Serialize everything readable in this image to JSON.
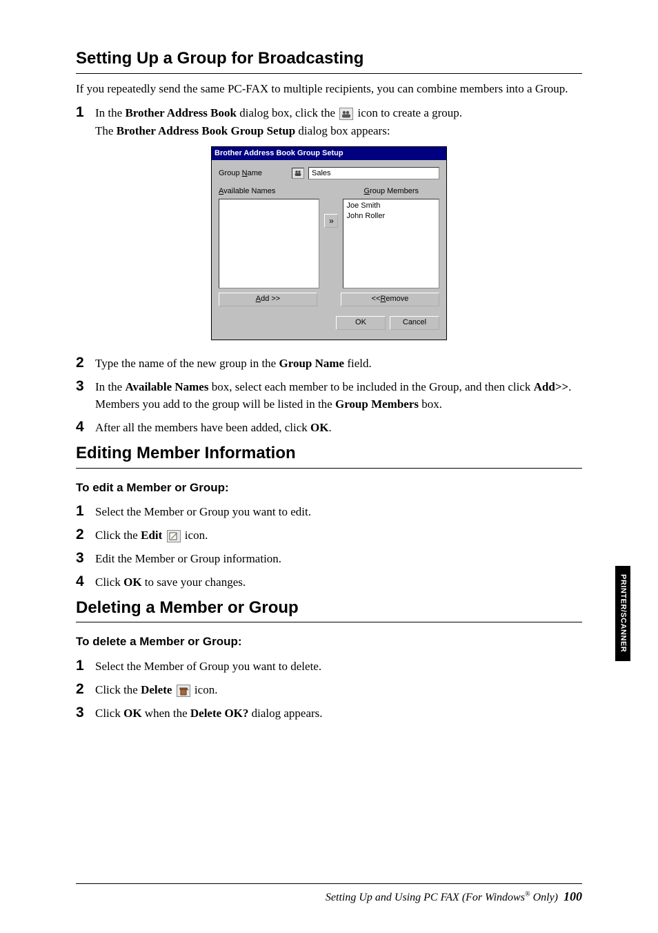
{
  "section1": {
    "heading": "Setting Up a Group for Broadcasting",
    "intro": "If you repeatedly send the same PC-FAX to multiple recipients, you can combine members into a Group.",
    "step1a": "In the ",
    "step1b": "Brother Address Book",
    "step1c": " dialog box, click the ",
    "step1d": " icon to create a group.",
    "step1line2a": "The ",
    "step1line2b": "Brother Address Book Group Setup",
    "step1line2c": " dialog box appears:",
    "step2a": "Type the name of the new group in the ",
    "step2b": "Group Name",
    "step2c": " field.",
    "step3a": "In the ",
    "step3b": "Available Names",
    "step3c": " box, select each member to be included in the Group, and then click ",
    "step3d": "Add>>",
    "step3e": ".",
    "step3line2a": "Members you add to the group will be listed in the ",
    "step3line2b": "Group Members",
    "step3line2c": " box.",
    "step4a": "After all the members have been added, click ",
    "step4b": "OK",
    "step4c": "."
  },
  "dialog": {
    "title": "Brother Address Book Group Setup",
    "groupNameLabel_pre": "Group ",
    "groupNameLabel_u": "N",
    "groupNameLabel_post": "ame",
    "groupNameValue": "Sales",
    "availableLabel_u": "A",
    "availableLabel_post": "vailable Names",
    "membersLabel_u": "G",
    "membersLabel_post": "roup Members",
    "member1": "Joe Smith",
    "member2": "John Roller",
    "arrow": "»",
    "addBtn_u": "A",
    "addBtn_post": "dd >>",
    "removeBtn_pre": "<< ",
    "removeBtn_u": "R",
    "removeBtn_post": "emove",
    "okBtn": "OK",
    "cancelBtn": "Cancel"
  },
  "section2": {
    "heading": "Editing Member Information",
    "subhead": "To edit a Member or Group:",
    "step1": "Select the Member or Group you want to edit.",
    "step2a": "Click the ",
    "step2b": "Edit",
    "step2c": " icon.",
    "step3": "Edit the Member or Group information.",
    "step4a": "Click ",
    "step4b": "OK",
    "step4c": " to save your changes."
  },
  "section3": {
    "heading": "Deleting a Member or Group",
    "subhead": "To delete a Member or Group:",
    "step1": "Select the Member of Group you want to delete.",
    "step2a": "Click the ",
    "step2b": "Delete",
    "step2c": " icon.",
    "step3a": "Click ",
    "step3b": "OK",
    "step3c": " when the ",
    "step3d": "Delete OK?",
    "step3e": " dialog appears."
  },
  "sidetab": "PRINTER/SCANNER",
  "footer": {
    "text_a": "Setting Up and Using PC FAX (For Windows",
    "text_b": " Only)",
    "reg": "®",
    "page": "100"
  },
  "nums": {
    "n1": "1",
    "n2": "2",
    "n3": "3",
    "n4": "4"
  }
}
